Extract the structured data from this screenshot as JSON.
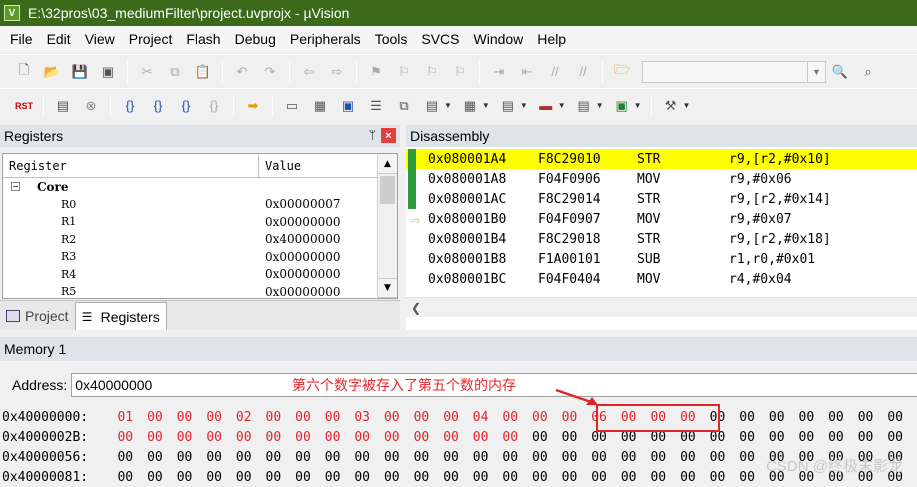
{
  "window": {
    "title": "E:\\32pros\\03_mediumFilter\\project.uvprojx - µVision"
  },
  "menu": [
    "File",
    "Edit",
    "View",
    "Project",
    "Flash",
    "Debug",
    "Peripherals",
    "Tools",
    "SVCS",
    "Window",
    "Help"
  ],
  "registers": {
    "title": "Registers",
    "col_register": "Register",
    "col_value": "Value",
    "group": "Core",
    "rows": [
      {
        "name": "R0",
        "value": "0x00000007"
      },
      {
        "name": "R1",
        "value": "0x00000000"
      },
      {
        "name": "R2",
        "value": "0x40000000"
      },
      {
        "name": "R3",
        "value": "0x00000000"
      },
      {
        "name": "R4",
        "value": "0x00000000"
      },
      {
        "name": "R5",
        "value": "0x00000000"
      }
    ],
    "tabs": [
      "Project",
      "Registers"
    ]
  },
  "disassembly": {
    "title": "Disassembly",
    "rows": [
      {
        "addr": "0x080001A4",
        "op": "F8C29010",
        "mnem": "STR",
        "args": "r9,[r2,#0x10]"
      },
      {
        "addr": "0x080001A8",
        "op": "F04F0906",
        "mnem": "MOV",
        "args": "r9,#0x06"
      },
      {
        "addr": "0x080001AC",
        "op": "F8C29014",
        "mnem": "STR",
        "args": "r9,[r2,#0x14]"
      },
      {
        "addr": "0x080001B0",
        "op": "F04F0907",
        "mnem": "MOV",
        "args": "r9,#0x07"
      },
      {
        "addr": "0x080001B4",
        "op": "F8C29018",
        "mnem": "STR",
        "args": "r9,[r2,#0x18]"
      },
      {
        "addr": "0x080001B8",
        "op": "F1A00101",
        "mnem": "SUB",
        "args": "r1,r0,#0x01"
      },
      {
        "addr": "0x080001BC",
        "op": "F04F0404",
        "mnem": "MOV",
        "args": "r4,#0x04"
      }
    ]
  },
  "memory": {
    "title": "Memory 1",
    "address_label": "Address:",
    "address_value": "0x40000000",
    "annotation": "第六个数字被存入了第五个数的内存",
    "rows": [
      {
        "addr": "0x40000000:",
        "bytes": [
          "01",
          "00",
          "00",
          "00",
          "02",
          "00",
          "00",
          "00",
          "03",
          "00",
          "00",
          "00",
          "04",
          "00",
          "00",
          "00",
          "06",
          "00",
          "00",
          "00",
          "00",
          "00",
          "00",
          "00",
          "00",
          "00",
          "00"
        ]
      },
      {
        "addr": "0x4000002B:",
        "bytes": [
          "00",
          "00",
          "00",
          "00",
          "00",
          "00",
          "00",
          "00",
          "00",
          "00",
          "00",
          "00",
          "00",
          "00",
          "00",
          "00",
          "00",
          "00",
          "00",
          "00",
          "00",
          "00",
          "00",
          "00",
          "00",
          "00",
          "00"
        ]
      },
      {
        "addr": "0x40000056:",
        "bytes": [
          "00",
          "00",
          "00",
          "00",
          "00",
          "00",
          "00",
          "00",
          "00",
          "00",
          "00",
          "00",
          "00",
          "00",
          "00",
          "00",
          "00",
          "00",
          "00",
          "00",
          "00",
          "00",
          "00",
          "00",
          "00",
          "00",
          "00"
        ]
      },
      {
        "addr": "0x40000081:",
        "bytes": [
          "00",
          "00",
          "00",
          "00",
          "00",
          "00",
          "00",
          "00",
          "00",
          "00",
          "00",
          "00",
          "00",
          "00",
          "00",
          "00",
          "00",
          "00",
          "00",
          "00",
          "00",
          "00",
          "00",
          "00",
          "00",
          "00",
          "00"
        ]
      }
    ]
  },
  "watermark": "CSDN @终极末影龙"
}
